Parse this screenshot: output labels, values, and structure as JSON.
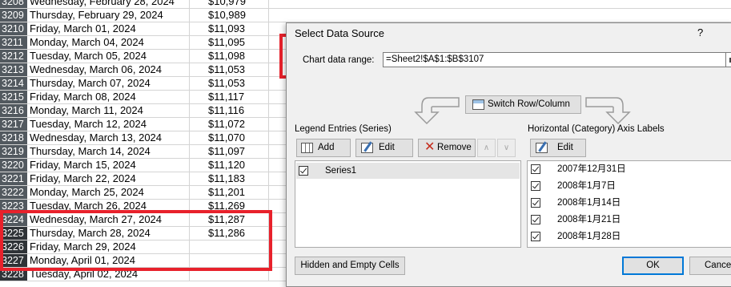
{
  "sheet": {
    "rows": [
      {
        "num": "3208",
        "date": "Wednesday, February 28, 2024",
        "value": "$10,979"
      },
      {
        "num": "3209",
        "date": "Thursday, February 29, 2024",
        "value": "$10,989"
      },
      {
        "num": "3210",
        "date": "Friday, March 01, 2024",
        "value": "$11,093"
      },
      {
        "num": "3211",
        "date": "Monday, March 04, 2024",
        "value": "$11,095"
      },
      {
        "num": "3212",
        "date": "Tuesday, March 05, 2024",
        "value": "$11,098"
      },
      {
        "num": "3213",
        "date": "Wednesday, March 06, 2024",
        "value": "$11,053"
      },
      {
        "num": "3214",
        "date": "Thursday, March 07, 2024",
        "value": "$11,053"
      },
      {
        "num": "3215",
        "date": "Friday, March 08, 2024",
        "value": "$11,117"
      },
      {
        "num": "3216",
        "date": "Monday, March 11, 2024",
        "value": "$11,116"
      },
      {
        "num": "3217",
        "date": "Tuesday, March 12, 2024",
        "value": "$11,072"
      },
      {
        "num": "3218",
        "date": "Wednesday, March 13, 2024",
        "value": "$11,070"
      },
      {
        "num": "3219",
        "date": "Thursday, March 14, 2024",
        "value": "$11,097"
      },
      {
        "num": "3220",
        "date": "Friday, March 15, 2024",
        "value": "$11,120"
      },
      {
        "num": "3221",
        "date": "Friday, March 22, 2024",
        "value": "$11,183"
      },
      {
        "num": "3222",
        "date": "Monday, March 25, 2024",
        "value": "$11,201"
      },
      {
        "num": "3223",
        "date": "Tuesday, March 26, 2024",
        "value": "$11,269"
      },
      {
        "num": "3224",
        "date": "Wednesday, March 27, 2024",
        "value": "$11,287"
      },
      {
        "num": "3225",
        "date": "Thursday, March 28, 2024",
        "value": "$11,286"
      },
      {
        "num": "3226",
        "date": "Friday, March 29, 2024",
        "value": ""
      },
      {
        "num": "3227",
        "date": "Monday, April 01, 2024",
        "value": ""
      },
      {
        "num": "3228",
        "date": "Tuesday, April 02, 2024",
        "value": ""
      }
    ]
  },
  "dialog": {
    "title": "Select Data Source",
    "help": "?",
    "range_label": "Chart data range:",
    "range_value": "=Sheet2!$A$1:$B$3107",
    "switch_label": "Switch Row/Column",
    "legend_title": "Legend Entries (Series)",
    "add_label": "Add",
    "edit_label": "Edit",
    "remove_label": "Remove",
    "up_symbol": "∧",
    "down_symbol": "∨",
    "series": [
      "Series1"
    ],
    "axis_title": "Horizontal (Category) Axis Labels",
    "axis_edit_label": "Edit",
    "axis_labels": [
      "2007年12月31日",
      "2008年1月7日",
      "2008年1月14日",
      "2008年1月21日",
      "2008年1月28日"
    ],
    "hidden_label": "Hidden and Empty Cells",
    "ok_label": "OK",
    "cancel_label": "Cancel"
  },
  "colors": {
    "annotation": "#e8212b",
    "rownum_bg": "#52595f",
    "dialog_bg": "#f0f0f0",
    "selection": "#e5e5e5",
    "focus": "#0078d7"
  }
}
